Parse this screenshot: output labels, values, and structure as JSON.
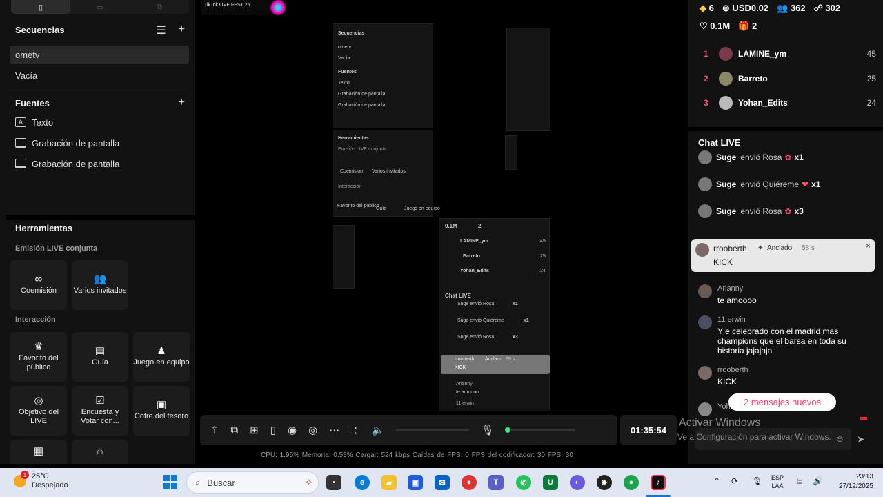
{
  "left_panel": {
    "sequences_title": "Secuencias",
    "sequences": [
      "ometv",
      "Vacía"
    ],
    "sources_title": "Fuentes",
    "sources": [
      "Texto",
      "Grabación de pantalla",
      "Grabación de pantalla"
    ],
    "tools_title": "Herramientas",
    "joint_live_title": "Emisión LIVE conjunta",
    "joint_tiles": [
      "Coemisión",
      "Varios invitados"
    ],
    "interaction_title": "Interacción",
    "interaction_tiles": [
      "Favorito del público",
      "Guía",
      "Juego en equipo",
      "Objetivo del LIVE",
      "Encuesta y Votar con...",
      "Cofre del tesoro"
    ]
  },
  "stage": {
    "logo_text": "TikTok LIVE FEST 25",
    "mirror": {
      "sequences_title": "Secuencias",
      "sequences": [
        "ometv",
        "Vacía"
      ],
      "sources_title": "Fuentes",
      "sources": [
        "Texto",
        "Grabación de pantalla",
        "Grabación de pantalla"
      ],
      "tools_title": "Herramientas",
      "joint_title": "Emisión LIVE conjunta",
      "joint": [
        "Coemisión",
        "Varios invitados"
      ],
      "interaction_title": "Interacción",
      "interaction": [
        "Favorito del público",
        "Guía",
        "Juego en equipo"
      ],
      "likes": "0.1M",
      "gifts": "2",
      "ranks": [
        "LAMINE_ym",
        "Barreto",
        "Yohan_Edits"
      ],
      "rank_points": [
        "45",
        "25",
        "24"
      ],
      "chat_title": "Chat LIVE",
      "gift_lines": [
        "Suge envió Rosa",
        "Suge envió Quiéreme",
        "Suge envió Rosa"
      ],
      "gift_counts": [
        "x1",
        "x1",
        "x3"
      ],
      "pinned_user": "rrooberth",
      "pinned_tag": "Anclado",
      "pinned_time": "59 s",
      "pinned_msg": "KICK",
      "chat_user": "Arianny",
      "chat_msg": "te amoooo",
      "chat_user2": "11 erwin"
    },
    "timer": "01:35:54",
    "stats": "CPU: 1.95%    Memoria: 0.53%    Cargar: 524 kbps    Caídas de FPS: 0    FPS del codificador: 30    FPS: 30"
  },
  "right_panel": {
    "diamonds": "6",
    "usd": "USD0.02",
    "viewers": "362",
    "followers": "302",
    "likes": "0.1M",
    "gifts": "2",
    "ranking": [
      {
        "rank": "1",
        "name": "LAMINE_ym",
        "points": "45"
      },
      {
        "rank": "2",
        "name": "Barreto",
        "points": "25"
      },
      {
        "rank": "3",
        "name": "Yohan_Edits",
        "points": "24"
      }
    ],
    "chat_title": "Chat LIVE",
    "gift_events": [
      {
        "user": "Suge",
        "action": "envió Rosa",
        "count": "x1"
      },
      {
        "user": "Suge",
        "action": "envió Quiéreme",
        "count": "x1"
      },
      {
        "user": "Suge",
        "action": "envió Rosa",
        "count": "x3"
      }
    ],
    "pinned": {
      "user": "rrooberth",
      "tag": "Anclado",
      "time": "58 s",
      "message": "KICK"
    },
    "messages": [
      {
        "user": "Arianny",
        "text": "te amoooo"
      },
      {
        "user": "11 erwin",
        "text": "Y e celebrado con el madrid mas champions que el barsa en toda su historia jajajaja"
      },
      {
        "user": "rrooberth",
        "text": "KICK"
      }
    ],
    "partial_user": "Yoh",
    "new_messages": "2 mensajes nuevos"
  },
  "watermark": {
    "line1": "Activar Windows",
    "line2": "Ve a Configuración para activar Windows."
  },
  "taskbar": {
    "temperature": "25°C",
    "weather": "Despejado",
    "weather_badge": "1",
    "search_placeholder": "Buscar",
    "language": "ESP",
    "region": "LAA",
    "time": "23:13",
    "date": "27/12/2025"
  }
}
